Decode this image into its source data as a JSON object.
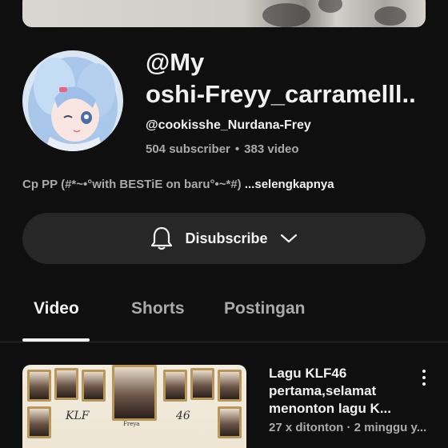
{
  "channel": {
    "title_line1": "@My",
    "title_line2": "oshi-Freyy_carramelll..",
    "handle": "@cookisshe_Nurdana-Frey",
    "subscriber_count": "504 subscriber",
    "separator": "•",
    "video_count": "383 video",
    "description": "Cp PP (#*~•°with BESTiE on baru°•~*#) ",
    "description_more": "...selengkapnya"
  },
  "subscribe_button": {
    "label": "Disubscribe",
    "bell_icon": "bell-icon",
    "chevron_icon": "chevron-down-icon"
  },
  "tabs": [
    {
      "label": "Video",
      "active": true
    },
    {
      "label": "Shorts",
      "active": false
    },
    {
      "label": "Postingan",
      "active": false
    }
  ],
  "videos": [
    {
      "title_line1": "Lagu KLF46",
      "title_line2": "pertama,selamat",
      "title_line3": "menonton lagu K...",
      "meta": "27 x ditonton · 2 minggu y...",
      "thumb_text_left": "KLF",
      "thumb_text_right": "46",
      "thumb_name_center": "Freya"
    }
  ],
  "colors": {
    "background": "#0f0f0f",
    "button_bg": "#272727",
    "text_primary": "#f1f1f1",
    "text_secondary": "#aaaaaa"
  }
}
